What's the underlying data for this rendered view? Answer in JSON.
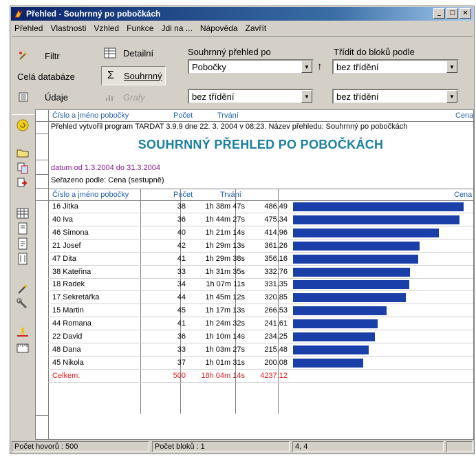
{
  "window": {
    "title": "Přehled - Souhrnný po pobočkách"
  },
  "menu": [
    "Přehled",
    "Vlastnosti",
    "Vzhled",
    "Funkce",
    "Jdi na ...",
    "Nápověda",
    "Zavřít"
  ],
  "toolbar": {
    "filter": "Filtr",
    "whole_db": "Celá databáze",
    "data": "Údaje",
    "detail": "Detailní",
    "summary": "Souhrnný",
    "graphs": "Grafy",
    "summary_by_label": "Souhrnný přehled po",
    "summary_by_value": "Pobočky",
    "sort_blocks_label": "Třídit do bloků podle",
    "sort_blocks_value": "bez třídění",
    "sort2_value": "bez třídění",
    "sort3_value": "bez třídění"
  },
  "report": {
    "header": {
      "branch": "Číslo a jméno pobočky",
      "count": "Počet",
      "duration": "Trvání",
      "price": "Cena"
    },
    "info": "Přehled vytvořil program TARDAT 3.9.9 dne 22. 3. 2004 v 08:23. Název přehledu: Souhrnný po pobočkách",
    "title": "SOUHRNNÝ PŘEHLED PO POBOČKÁCH",
    "date_range": "datum od 1.3.2004 do 31.3.2004",
    "sorted_by": "Seřazeno podle: Cena (sestupně)",
    "columns": {
      "branch": "Číslo a jméno pobočky",
      "count": "Počet",
      "duration": "Trvání",
      "price": "Cena"
    },
    "rows": [
      {
        "branch": "16 Jitka",
        "count": "38",
        "duration": "1h 38m 47s",
        "price": "486,49",
        "value": 486.49
      },
      {
        "branch": "40 Iva",
        "count": "36",
        "duration": "1h 44m 27s",
        "price": "475,34",
        "value": 475.34
      },
      {
        "branch": "46 Simona",
        "count": "40",
        "duration": "1h 21m 14s",
        "price": "414,96",
        "value": 414.96
      },
      {
        "branch": "21 Josef",
        "count": "42",
        "duration": "1h 29m 13s",
        "price": "361,26",
        "value": 361.26
      },
      {
        "branch": "47 Dita",
        "count": "41",
        "duration": "1h 29m 38s",
        "price": "356,16",
        "value": 356.16
      },
      {
        "branch": "38 Kateřina",
        "count": "33",
        "duration": "1h 31m 35s",
        "price": "332,76",
        "value": 332.76
      },
      {
        "branch": "18 Radek",
        "count": "34",
        "duration": "1h 07m 11s",
        "price": "331,35",
        "value": 331.35
      },
      {
        "branch": "17 Sekretářka",
        "count": "44",
        "duration": "1h 45m 12s",
        "price": "320,85",
        "value": 320.85
      },
      {
        "branch": "15 Martin",
        "count": "45",
        "duration": "1h 17m 13s",
        "price": "266,53",
        "value": 266.53
      },
      {
        "branch": "44 Romana",
        "count": "41",
        "duration": "1h 24m 32s",
        "price": "241,61",
        "value": 241.61
      },
      {
        "branch": "22 David",
        "count": "36",
        "duration": "1h 10m 14s",
        "price": "234,25",
        "value": 234.25
      },
      {
        "branch": "48 Dana",
        "count": "33",
        "duration": "1h 03m 27s",
        "price": "215,48",
        "value": 215.48
      },
      {
        "branch": "45 Nikola",
        "count": "37",
        "duration": "1h 01m 31s",
        "price": "200,08",
        "value": 200.08
      }
    ],
    "total": {
      "branch": "Celkem:",
      "count": "500",
      "duration": "18h 04m 14s",
      "price": "4237,12"
    }
  },
  "colors": {
    "bar": "#1a3fa8",
    "title": "#1a7fa0",
    "header": "#1f5fb0",
    "total": "#e02020",
    "date": "#8a1a9a"
  },
  "status": {
    "calls": "Počet hovorů : 500",
    "blocks": "Počet bloků : 1",
    "pos": "4, 4"
  }
}
